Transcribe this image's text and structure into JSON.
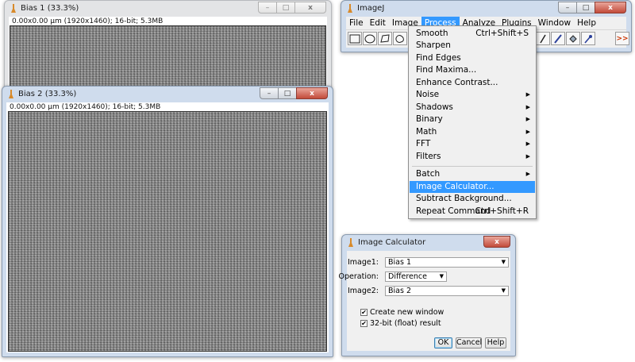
{
  "windows": {
    "bias1": {
      "title": "Bias 1 (33.3%)",
      "info": "0.00x0.00 µm (1920x1460); 16-bit; 5.3MB"
    },
    "bias2": {
      "title": "Bias 2 (33.3%)",
      "info": "0.00x0.00 µm (1920x1460); 16-bit; 5.3MB"
    },
    "imagej": {
      "title": "ImageJ",
      "menu": [
        "File",
        "Edit",
        "Image",
        "Process",
        "Analyze",
        "Plugins",
        "Window",
        "Help"
      ],
      "toolbar_overflow": ">>"
    }
  },
  "process_menu": {
    "items": [
      {
        "label": "Smooth",
        "shortcut": "Ctrl+Shift+S"
      },
      {
        "label": "Sharpen"
      },
      {
        "label": "Find Edges"
      },
      {
        "label": "Find Maxima..."
      },
      {
        "label": "Enhance Contrast..."
      },
      {
        "label": "Noise",
        "submenu": true
      },
      {
        "label": "Shadows",
        "submenu": true
      },
      {
        "label": "Binary",
        "submenu": true
      },
      {
        "label": "Math",
        "submenu": true
      },
      {
        "label": "FFT",
        "submenu": true
      },
      {
        "label": "Filters",
        "submenu": true
      },
      {
        "label": "Batch",
        "submenu": true
      },
      {
        "label": "Image Calculator...",
        "highlighted": true
      },
      {
        "label": "Subtract Background..."
      },
      {
        "label": "Repeat Command",
        "shortcut": "Ctrl+Shift+R"
      }
    ]
  },
  "calculator": {
    "title": "Image Calculator",
    "image1_label": "Image1:",
    "image1_value": "Bias 1",
    "operation_label": "Operation:",
    "operation_value": "Difference",
    "image2_label": "Image2:",
    "image2_value": "Bias 2",
    "create_new_window_label": "Create new window",
    "create_new_window_checked": true,
    "float_result_label": "32-bit (float) result",
    "float_result_checked": true,
    "ok_label": "OK",
    "cancel_label": "Cancel",
    "help_label": "Help"
  },
  "glyphs": {
    "minimize": "–",
    "maximize": "□",
    "close": "x",
    "submenu_arrow": "▶",
    "combo_arrow": "▼",
    "check": "✔"
  },
  "colors": {
    "menu_highlight": "#3399ff",
    "titlebar_active": "#cfdced",
    "titlebar_inactive": "#e3e4e6"
  }
}
